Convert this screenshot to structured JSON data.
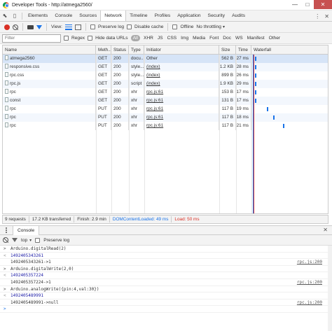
{
  "window": {
    "title": "Developer Tools - http://atmega2560/"
  },
  "devtools": {
    "tabs": [
      "Elements",
      "Console",
      "Sources",
      "Network",
      "Timeline",
      "Profiles",
      "Application",
      "Security",
      "Audits"
    ],
    "active_tab": "Network"
  },
  "network_toolbar": {
    "view_label": "View:",
    "preserve_log": "Preserve log",
    "disable_cache": "Disable cache",
    "offline": "Offline",
    "throttling": "No throttling"
  },
  "filter_bar": {
    "placeholder": "Filter",
    "regex": "Regex",
    "hide_data_urls": "Hide data URLs",
    "types": [
      "All",
      "XHR",
      "JS",
      "CSS",
      "Img",
      "Media",
      "Font",
      "Doc",
      "WS",
      "Manifest",
      "Other"
    ],
    "active_type": "All"
  },
  "table": {
    "columns": [
      "Name",
      "Meth...",
      "Status",
      "Type",
      "Initiator",
      "Size",
      "Time",
      "Waterfall"
    ],
    "rows": [
      {
        "name": "atmega2560",
        "method": "GET",
        "status": "200",
        "type": "docu...",
        "initiator": "Other",
        "initiator_link": false,
        "size": "562 B",
        "time": "27 ms"
      },
      {
        "name": "responsive.css",
        "method": "GET",
        "status": "200",
        "type": "style...",
        "initiator": "(index)",
        "initiator_link": true,
        "size": "1.2 KB",
        "time": "28 ms"
      },
      {
        "name": "rpc.css",
        "method": "GET",
        "status": "200",
        "type": "style...",
        "initiator": "(index)",
        "initiator_link": true,
        "size": "899 B",
        "time": "26 ms"
      },
      {
        "name": "rpc.js",
        "method": "GET",
        "status": "200",
        "type": "script",
        "initiator": "(index)",
        "initiator_link": true,
        "size": "1.9 KB",
        "time": "29 ms"
      },
      {
        "name": "rpc",
        "method": "GET",
        "status": "200",
        "type": "xhr",
        "initiator": "rpc.js:61",
        "initiator_link": true,
        "size": "153 B",
        "time": "17 ms"
      },
      {
        "name": "const",
        "method": "GET",
        "status": "200",
        "type": "xhr",
        "initiator": "rpc.js:61",
        "initiator_link": true,
        "size": "131 B",
        "time": "17 ms"
      },
      {
        "name": "rpc",
        "method": "PUT",
        "status": "200",
        "type": "xhr",
        "initiator": "rpc.js:61",
        "initiator_link": true,
        "size": "117 B",
        "time": "19 ms"
      },
      {
        "name": "rpc",
        "method": "PUT",
        "status": "200",
        "type": "xhr",
        "initiator": "rpc.js:61",
        "initiator_link": true,
        "size": "117 B",
        "time": "18 ms"
      },
      {
        "name": "rpc",
        "method": "PUT",
        "status": "200",
        "type": "xhr",
        "initiator": "rpc.js:61",
        "initiator_link": true,
        "size": "117 B",
        "time": "21 ms"
      }
    ]
  },
  "summary": {
    "requests": "9 requests",
    "transferred": "17.2 KB transferred",
    "finish": "Finish: 2.9 min",
    "dom_content_loaded": "DOMContentLoaded: 49 ms",
    "load": "Load: 50 ms"
  },
  "drawer": {
    "tab": "Console",
    "context": "top",
    "preserve_log": "Preserve log"
  },
  "console": {
    "lines": [
      {
        "kind": "in",
        "prefix": ">",
        "text": "Arduino.digitalRead(2)",
        "src": ""
      },
      {
        "kind": "out",
        "prefix": "<",
        "text": "1492405343261",
        "src": ""
      },
      {
        "kind": "log",
        "prefix": "",
        "text": "1492405343261->1",
        "src": "rpc.js:200"
      },
      {
        "kind": "in",
        "prefix": ">",
        "text": "Arduino.digitalWrite(2,0)",
        "src": ""
      },
      {
        "kind": "out",
        "prefix": "<",
        "text": "1492405357224",
        "src": ""
      },
      {
        "kind": "log",
        "prefix": "",
        "text": "1492405357224->1",
        "src": "rpc.js:200"
      },
      {
        "kind": "in",
        "prefix": ">",
        "text": "Arduino.analogWrite({pin:4,val:30})",
        "src": ""
      },
      {
        "kind": "out",
        "prefix": "<",
        "text": "1492405489991",
        "src": ""
      },
      {
        "kind": "log",
        "prefix": "",
        "text": "1492405489991->null",
        "src": "rpc.js:200"
      },
      {
        "kind": "prompt",
        "prefix": ">",
        "text": "",
        "src": ""
      }
    ]
  },
  "colors": {
    "accent": "#1a73e8",
    "record": "#d93025",
    "close_button": "#c75050",
    "load_line": "#e53935"
  }
}
